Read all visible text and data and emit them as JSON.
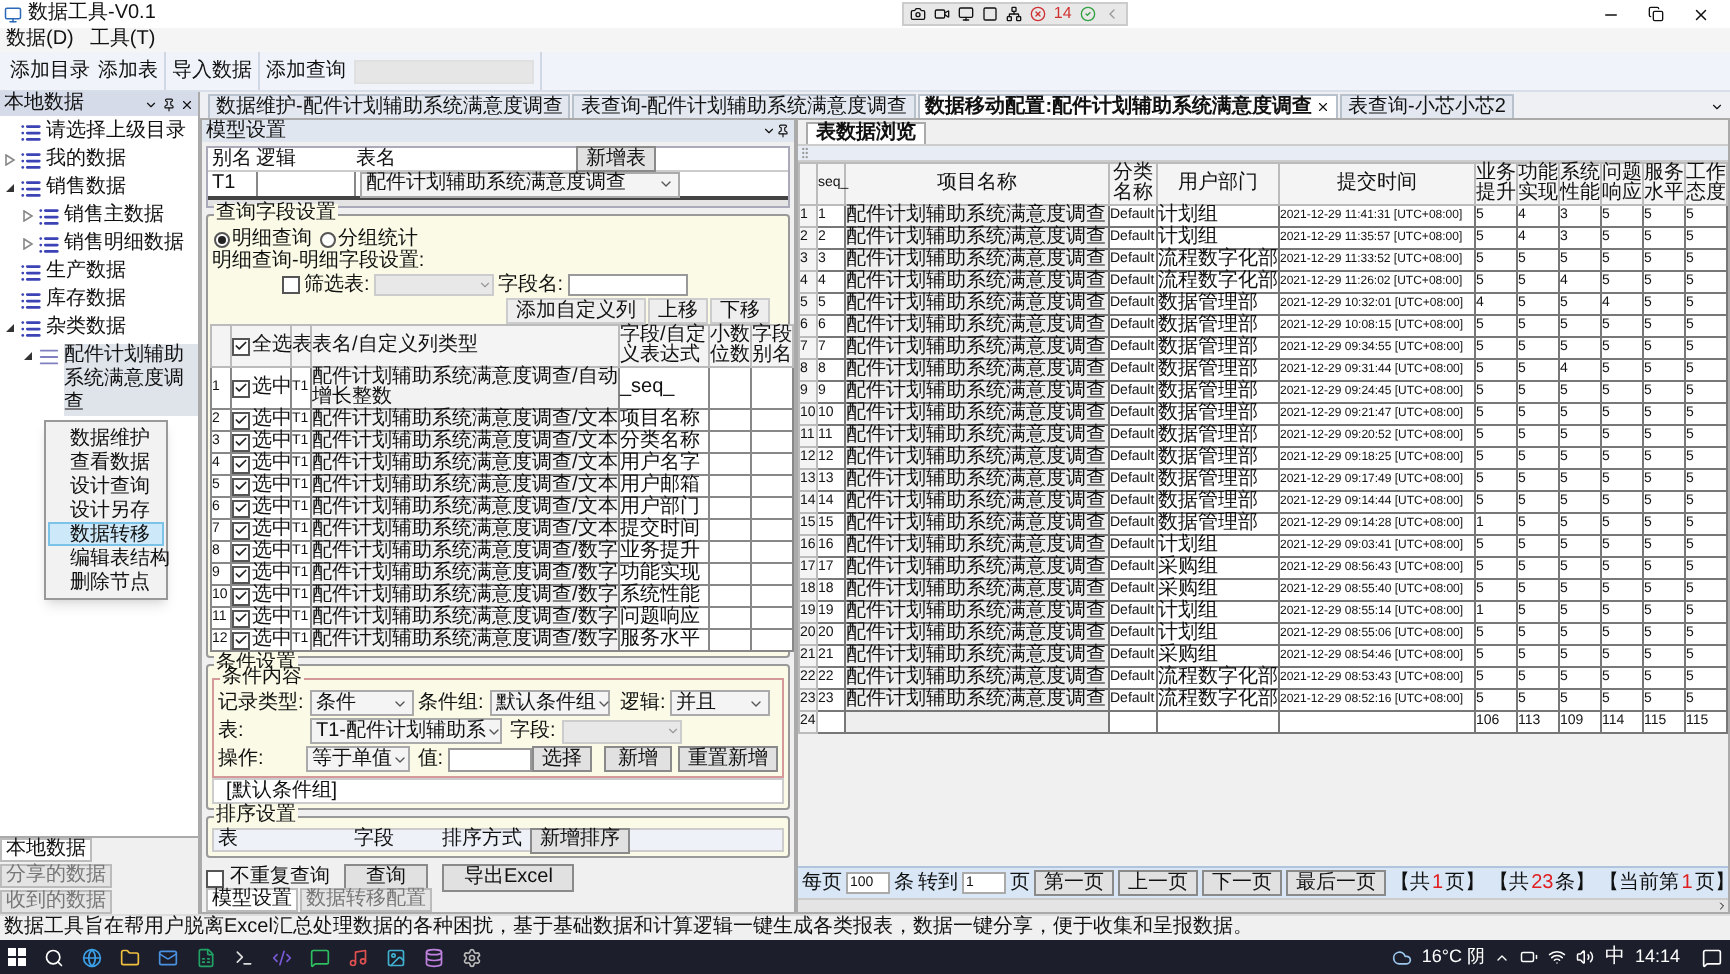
{
  "window": {
    "title": "数据工具-V0.1"
  },
  "quick_toolbar": {
    "error_count": "14"
  },
  "menu": [
    "数据(D)",
    "工具(T)"
  ],
  "toolbar": [
    {
      "buttons": [
        "添加目录",
        "添加表"
      ],
      "has_field": false
    },
    {
      "buttons": [
        "导入数据"
      ],
      "has_field": false
    },
    {
      "buttons": [
        "添加查询"
      ],
      "has_field": true
    }
  ],
  "left_panel": {
    "title": "本地数据",
    "tree": [
      {
        "label": "请选择上级目录",
        "kind": "folder",
        "selected": false
      },
      {
        "label": "我的数据",
        "kind": "folder",
        "expanded": false,
        "selected": false
      },
      {
        "label": "销售数据",
        "kind": "folder",
        "expanded": true,
        "selected": false,
        "children": [
          {
            "label": "销售主数据",
            "kind": "folder",
            "expanded": false,
            "selected": false
          },
          {
            "label": "销售明细数据",
            "kind": "folder",
            "expanded": false,
            "selected": false
          }
        ]
      },
      {
        "label": "生产数据",
        "kind": "folder",
        "selected": false
      },
      {
        "label": "库存数据",
        "kind": "folder",
        "selected": false
      },
      {
        "label": "杂类数据",
        "kind": "folder",
        "expanded": true,
        "selected": false,
        "children": [
          {
            "label": "配件计划辅助系统满意度调查",
            "kind": "table",
            "expanded": true,
            "selected": true
          }
        ]
      }
    ],
    "context_menu": [
      {
        "label": "数据维护",
        "selected": false
      },
      {
        "label": "查看数据",
        "selected": false
      },
      {
        "label": "设计查询",
        "selected": false
      },
      {
        "label": "设计另存",
        "selected": false
      },
      {
        "label": "数据转移",
        "selected": true
      },
      {
        "label": "编辑表结构",
        "selected": false
      },
      {
        "label": "删除节点",
        "selected": false
      }
    ],
    "tabs": [
      {
        "label": "本地数据",
        "selected": true
      },
      {
        "label": "分享的数据",
        "selected": false
      },
      {
        "label": "收到的数据",
        "selected": false
      }
    ]
  },
  "doc_tabs": [
    {
      "label": "数据维护-配件计划辅助系统满意度调查",
      "selected": false
    },
    {
      "label": "表查询-配件计划辅助系统满意度调查",
      "selected": false
    },
    {
      "label": "数据移动配置:配件计划辅助系统满意度调查",
      "selected": true
    },
    {
      "label": "表查询-小芯小芯2",
      "selected": false
    }
  ],
  "model_panel": {
    "title": "模型设置",
    "model_table": {
      "columns": [
        "别名",
        "逻辑",
        "表名"
      ],
      "add_button": "新增表",
      "rows": [
        {
          "alias": "T1",
          "table": "配件计划辅助系统满意度调查"
        }
      ]
    },
    "query_fields": {
      "legend": "查询字段设置",
      "modes": [
        {
          "label": "明细查询",
          "selected": true
        },
        {
          "label": "分组统计",
          "selected": false
        }
      ],
      "subtitle": "明细查询-明细字段设置:",
      "filter": {
        "label": "筛选表:",
        "checked": false,
        "field_label": "字段名:"
      },
      "buttons": [
        "添加自定义列",
        "上移",
        "下移"
      ],
      "select_all": {
        "label": "全选",
        "checked": true
      },
      "columns": [
        "表",
        "表名/自定义列类型",
        "字段/自定义表达式",
        "小数位数",
        "字段别名"
      ],
      "rows": [
        {
          "n": "1",
          "checked": true,
          "check_label": "选中",
          "table": "T1",
          "type": "配件计划辅助系统满意度调查/自动增长整数",
          "field": "_seq_"
        },
        {
          "n": "2",
          "checked": true,
          "check_label": "选中",
          "table": "T1",
          "type": "配件计划辅助系统满意度调查/文本",
          "field": "项目名称"
        },
        {
          "n": "3",
          "checked": true,
          "check_label": "选中",
          "table": "T1",
          "type": "配件计划辅助系统满意度调查/文本",
          "field": "分类名称"
        },
        {
          "n": "4",
          "checked": true,
          "check_label": "选中",
          "table": "T1",
          "type": "配件计划辅助系统满意度调查/文本",
          "field": "用户名字"
        },
        {
          "n": "5",
          "checked": true,
          "check_label": "选中",
          "table": "T1",
          "type": "配件计划辅助系统满意度调查/文本",
          "field": "用户邮箱"
        },
        {
          "n": "6",
          "checked": true,
          "check_label": "选中",
          "table": "T1",
          "type": "配件计划辅助系统满意度调查/文本",
          "field": "用户部门"
        },
        {
          "n": "7",
          "checked": true,
          "check_label": "选中",
          "table": "T1",
          "type": "配件计划辅助系统满意度调查/文本",
          "field": "提交时间"
        },
        {
          "n": "8",
          "checked": true,
          "check_label": "选中",
          "table": "T1",
          "type": "配件计划辅助系统满意度调查/数字",
          "field": "业务提升"
        },
        {
          "n": "9",
          "checked": true,
          "check_label": "选中",
          "table": "T1",
          "type": "配件计划辅助系统满意度调查/数字",
          "field": "功能实现"
        },
        {
          "n": "10",
          "checked": true,
          "check_label": "选中",
          "table": "T1",
          "type": "配件计划辅助系统满意度调查/数字",
          "field": "系统性能"
        },
        {
          "n": "11",
          "checked": true,
          "check_label": "选中",
          "table": "T1",
          "type": "配件计划辅助系统满意度调查/数字",
          "field": "问题响应"
        },
        {
          "n": "12",
          "checked": true,
          "check_label": "选中",
          "table": "T1",
          "type": "配件计划辅助系统满意度调查/数字",
          "field": "服务水平"
        }
      ]
    },
    "conditions": {
      "legend": "条件设置",
      "inner_legend": "条件内容",
      "record_type": {
        "label": "记录类型:",
        "value": "条件"
      },
      "group": {
        "label": "条件组:",
        "value": "默认条件组"
      },
      "logic": {
        "label": "逻辑:",
        "value": "并且"
      },
      "table": {
        "label": "表:",
        "value": "T1-配件计划辅助系"
      },
      "field": {
        "label": "字段:"
      },
      "operation": {
        "label": "操作:",
        "value": "等于单值"
      },
      "value": {
        "label": "值:"
      },
      "pick_button": "选择",
      "add_button": "新增",
      "reset_button": "重置新增",
      "group_list": [
        "[默认条件组]"
      ]
    },
    "sort": {
      "legend": "排序设置",
      "columns": [
        "表",
        "字段",
        "排序方式"
      ],
      "add_button": "新增排序"
    },
    "distinct": {
      "label": "不重复查询",
      "checked": false
    },
    "actions": [
      "查询",
      "导出Excel"
    ],
    "bottom_tabs": [
      {
        "label": "模型设置",
        "selected": true
      },
      {
        "label": "数据转移配置",
        "selected": false
      }
    ]
  },
  "browse_panel": {
    "tabs": [
      {
        "label": "表数据浏览",
        "selected": true
      }
    ],
    "columns": [
      "seq_",
      "项目名称",
      "分类名称",
      "用户部门",
      "提交时间",
      "业务提升",
      "功能实现",
      "系统性能",
      "问题响应",
      "服务水平",
      "工作态度"
    ],
    "rows": [
      {
        "n": "1",
        "cells": [
          "1",
          "配件计划辅助系统满意度调查",
          "Default",
          "计划组",
          "2021-12-29 11:41:31 [UTC+08:00]",
          "5",
          "4",
          "3",
          "5",
          "5",
          "5"
        ]
      },
      {
        "n": "2",
        "cells": [
          "2",
          "配件计划辅助系统满意度调查",
          "Default",
          "计划组",
          "2021-12-29 11:35:57 [UTC+08:00]",
          "5",
          "4",
          "3",
          "5",
          "5",
          "5"
        ]
      },
      {
        "n": "3",
        "cells": [
          "3",
          "配件计划辅助系统满意度调查",
          "Default",
          "流程数字化部",
          "2021-12-29 11:33:52 [UTC+08:00]",
          "5",
          "5",
          "5",
          "5",
          "5",
          "5"
        ]
      },
      {
        "n": "4",
        "cells": [
          "4",
          "配件计划辅助系统满意度调查",
          "Default",
          "流程数字化部",
          "2021-12-29 11:26:02 [UTC+08:00]",
          "5",
          "5",
          "4",
          "5",
          "5",
          "5"
        ]
      },
      {
        "n": "5",
        "cells": [
          "5",
          "配件计划辅助系统满意度调查",
          "Default",
          "数据管理部",
          "2021-12-29 10:32:01 [UTC+08:00]",
          "4",
          "5",
          "5",
          "4",
          "5",
          "5"
        ]
      },
      {
        "n": "6",
        "cells": [
          "6",
          "配件计划辅助系统满意度调查",
          "Default",
          "数据管理部",
          "2021-12-29 10:08:15 [UTC+08:00]",
          "5",
          "5",
          "5",
          "5",
          "5",
          "5"
        ]
      },
      {
        "n": "7",
        "cells": [
          "7",
          "配件计划辅助系统满意度调查",
          "Default",
          "数据管理部",
          "2021-12-29 09:34:55 [UTC+08:00]",
          "5",
          "5",
          "5",
          "5",
          "5",
          "5"
        ]
      },
      {
        "n": "8",
        "cells": [
          "8",
          "配件计划辅助系统满意度调查",
          "Default",
          "数据管理部",
          "2021-12-29 09:31:44 [UTC+08:00]",
          "5",
          "5",
          "4",
          "5",
          "5",
          "5"
        ]
      },
      {
        "n": "9",
        "cells": [
          "9",
          "配件计划辅助系统满意度调查",
          "Default",
          "数据管理部",
          "2021-12-29 09:24:45 [UTC+08:00]",
          "5",
          "5",
          "5",
          "5",
          "5",
          "5"
        ]
      },
      {
        "n": "10",
        "cells": [
          "10",
          "配件计划辅助系统满意度调查",
          "Default",
          "数据管理部",
          "2021-12-29 09:21:47 [UTC+08:00]",
          "5",
          "5",
          "5",
          "5",
          "5",
          "5"
        ]
      },
      {
        "n": "11",
        "cells": [
          "11",
          "配件计划辅助系统满意度调查",
          "Default",
          "数据管理部",
          "2021-12-29 09:20:52 [UTC+08:00]",
          "5",
          "5",
          "5",
          "5",
          "5",
          "5"
        ]
      },
      {
        "n": "12",
        "cells": [
          "12",
          "配件计划辅助系统满意度调查",
          "Default",
          "数据管理部",
          "2021-12-29 09:18:25 [UTC+08:00]",
          "5",
          "5",
          "5",
          "5",
          "5",
          "5"
        ]
      },
      {
        "n": "13",
        "cells": [
          "13",
          "配件计划辅助系统满意度调查",
          "Default",
          "数据管理部",
          "2021-12-29 09:17:49 [UTC+08:00]",
          "5",
          "5",
          "5",
          "5",
          "5",
          "5"
        ]
      },
      {
        "n": "14",
        "cells": [
          "14",
          "配件计划辅助系统满意度调查",
          "Default",
          "数据管理部",
          "2021-12-29 09:14:44 [UTC+08:00]",
          "5",
          "5",
          "5",
          "5",
          "5",
          "5"
        ]
      },
      {
        "n": "15",
        "cells": [
          "15",
          "配件计划辅助系统满意度调查",
          "Default",
          "数据管理部",
          "2021-12-29 09:14:28 [UTC+08:00]",
          "1",
          "5",
          "5",
          "5",
          "5",
          "5"
        ]
      },
      {
        "n": "16",
        "cells": [
          "16",
          "配件计划辅助系统满意度调查",
          "Default",
          "计划组",
          "2021-12-29 09:03:41 [UTC+08:00]",
          "5",
          "5",
          "5",
          "5",
          "5",
          "5"
        ]
      },
      {
        "n": "17",
        "cells": [
          "17",
          "配件计划辅助系统满意度调查",
          "Default",
          "采购组",
          "2021-12-29 08:56:43 [UTC+08:00]",
          "5",
          "5",
          "5",
          "5",
          "5",
          "5"
        ]
      },
      {
        "n": "18",
        "cells": [
          "18",
          "配件计划辅助系统满意度调查",
          "Default",
          "采购组",
          "2021-12-29 08:55:40 [UTC+08:00]",
          "5",
          "5",
          "5",
          "5",
          "5",
          "5"
        ]
      },
      {
        "n": "19",
        "cells": [
          "19",
          "配件计划辅助系统满意度调查",
          "Default",
          "计划组",
          "2021-12-29 08:55:14 [UTC+08:00]",
          "1",
          "5",
          "5",
          "5",
          "5",
          "5"
        ]
      },
      {
        "n": "20",
        "cells": [
          "20",
          "配件计划辅助系统满意度调查",
          "Default",
          "计划组",
          "2021-12-29 08:55:06 [UTC+08:00]",
          "5",
          "5",
          "5",
          "5",
          "5",
          "5"
        ]
      },
      {
        "n": "21",
        "cells": [
          "21",
          "配件计划辅助系统满意度调查",
          "Default",
          "采购组",
          "2021-12-29 08:54:46 [UTC+08:00]",
          "5",
          "5",
          "5",
          "5",
          "5",
          "5"
        ]
      },
      {
        "n": "22",
        "cells": [
          "22",
          "配件计划辅助系统满意度调查",
          "Default",
          "流程数字化部",
          "2021-12-29 08:53:43 [UTC+08:00]",
          "5",
          "5",
          "5",
          "5",
          "5",
          "5"
        ]
      },
      {
        "n": "23",
        "cells": [
          "23",
          "配件计划辅助系统满意度调查",
          "Default",
          "流程数字化部",
          "2021-12-29 08:52:16 [UTC+08:00]",
          "5",
          "5",
          "5",
          "5",
          "5",
          "5"
        ]
      },
      {
        "n": "24",
        "cells": [
          null,
          null,
          null,
          null,
          null,
          "106",
          "113",
          "109",
          "114",
          "115",
          "115"
        ]
      }
    ],
    "pager": {
      "per_page_label": "每页",
      "per_page": "100",
      "per_page_unit": "条",
      "goto_label": "转到",
      "goto": "1",
      "goto_unit": "页",
      "buttons": [
        "第一页",
        "上一页",
        "下一页",
        "最后一页"
      ],
      "counts": [
        {
          "prefix": "【共",
          "value": "1",
          "suffix": "页】"
        },
        {
          "prefix": "【共",
          "value": "23",
          "suffix": "条】"
        },
        {
          "prefix": "【当前第",
          "value": "1",
          "suffix": "页】"
        }
      ]
    }
  },
  "status_bar": "数据工具旨在帮用户脱离Excel汇总处理数据的各种困扰，基于基础数据和计算逻辑一键生成各类报表，数据一键分享，便于收集和呈报数据。",
  "taskbar": {
    "weather": "16°C 阴",
    "ime": "中",
    "time": "14:14"
  }
}
